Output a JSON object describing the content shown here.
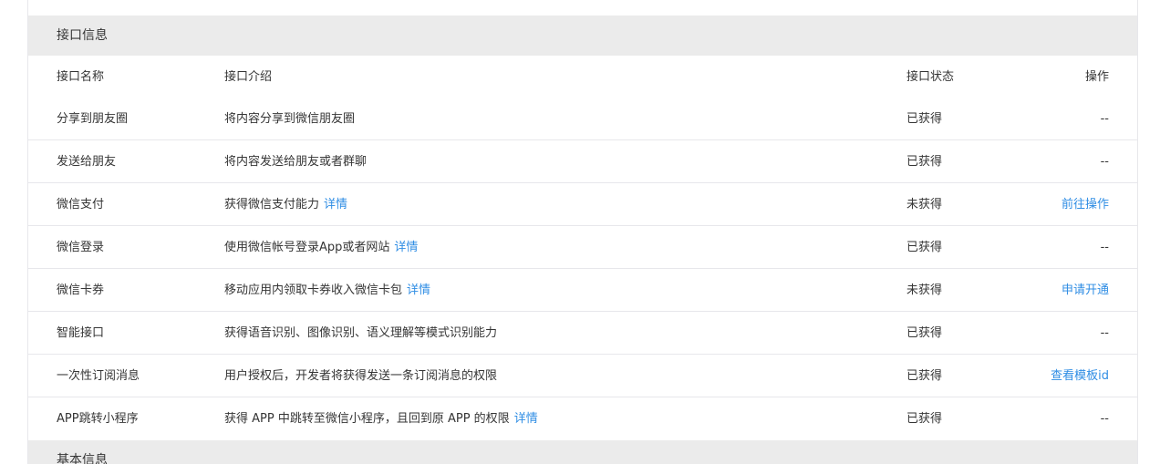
{
  "section_api": {
    "title": "接口信息"
  },
  "section_basic": {
    "title": "基本信息"
  },
  "columns": {
    "name": "接口名称",
    "desc": "接口介绍",
    "status": "接口状态",
    "op": "操作"
  },
  "rows": [
    {
      "name": "分享到朋友圈",
      "desc": "将内容分享到微信朋友圈",
      "detail": "",
      "status": "已获得",
      "op": "--",
      "op_link": false
    },
    {
      "name": "发送给朋友",
      "desc": "将内容发送给朋友或者群聊",
      "detail": "",
      "status": "已获得",
      "op": "--",
      "op_link": false
    },
    {
      "name": "微信支付",
      "desc": "获得微信支付能力",
      "detail": "详情",
      "status": "未获得",
      "op": "前往操作",
      "op_link": true
    },
    {
      "name": "微信登录",
      "desc": "使用微信帐号登录App或者网站",
      "detail": "详情",
      "status": "已获得",
      "op": "--",
      "op_link": false
    },
    {
      "name": "微信卡券",
      "desc": "移动应用内领取卡券收入微信卡包",
      "detail": "详情",
      "status": "未获得",
      "op": "申请开通",
      "op_link": true
    },
    {
      "name": "智能接口",
      "desc": "获得语音识别、图像识别、语义理解等模式识别能力",
      "detail": "",
      "status": "已获得",
      "op": "--",
      "op_link": false
    },
    {
      "name": "一次性订阅消息",
      "desc": "用户授权后，开发者将获得发送一条订阅消息的权限",
      "detail": "",
      "status": "已获得",
      "op": "查看模板id",
      "op_link": true
    },
    {
      "name": "APP跳转小程序",
      "desc": "获得 APP 中跳转至微信小程序，且回到原 APP 的权限",
      "detail": "详情",
      "status": "已获得",
      "op": "--",
      "op_link": false
    }
  ],
  "colors": {
    "link": "#2f8de4",
    "header_bg": "#ebebeb",
    "border": "#e7e7eb"
  }
}
